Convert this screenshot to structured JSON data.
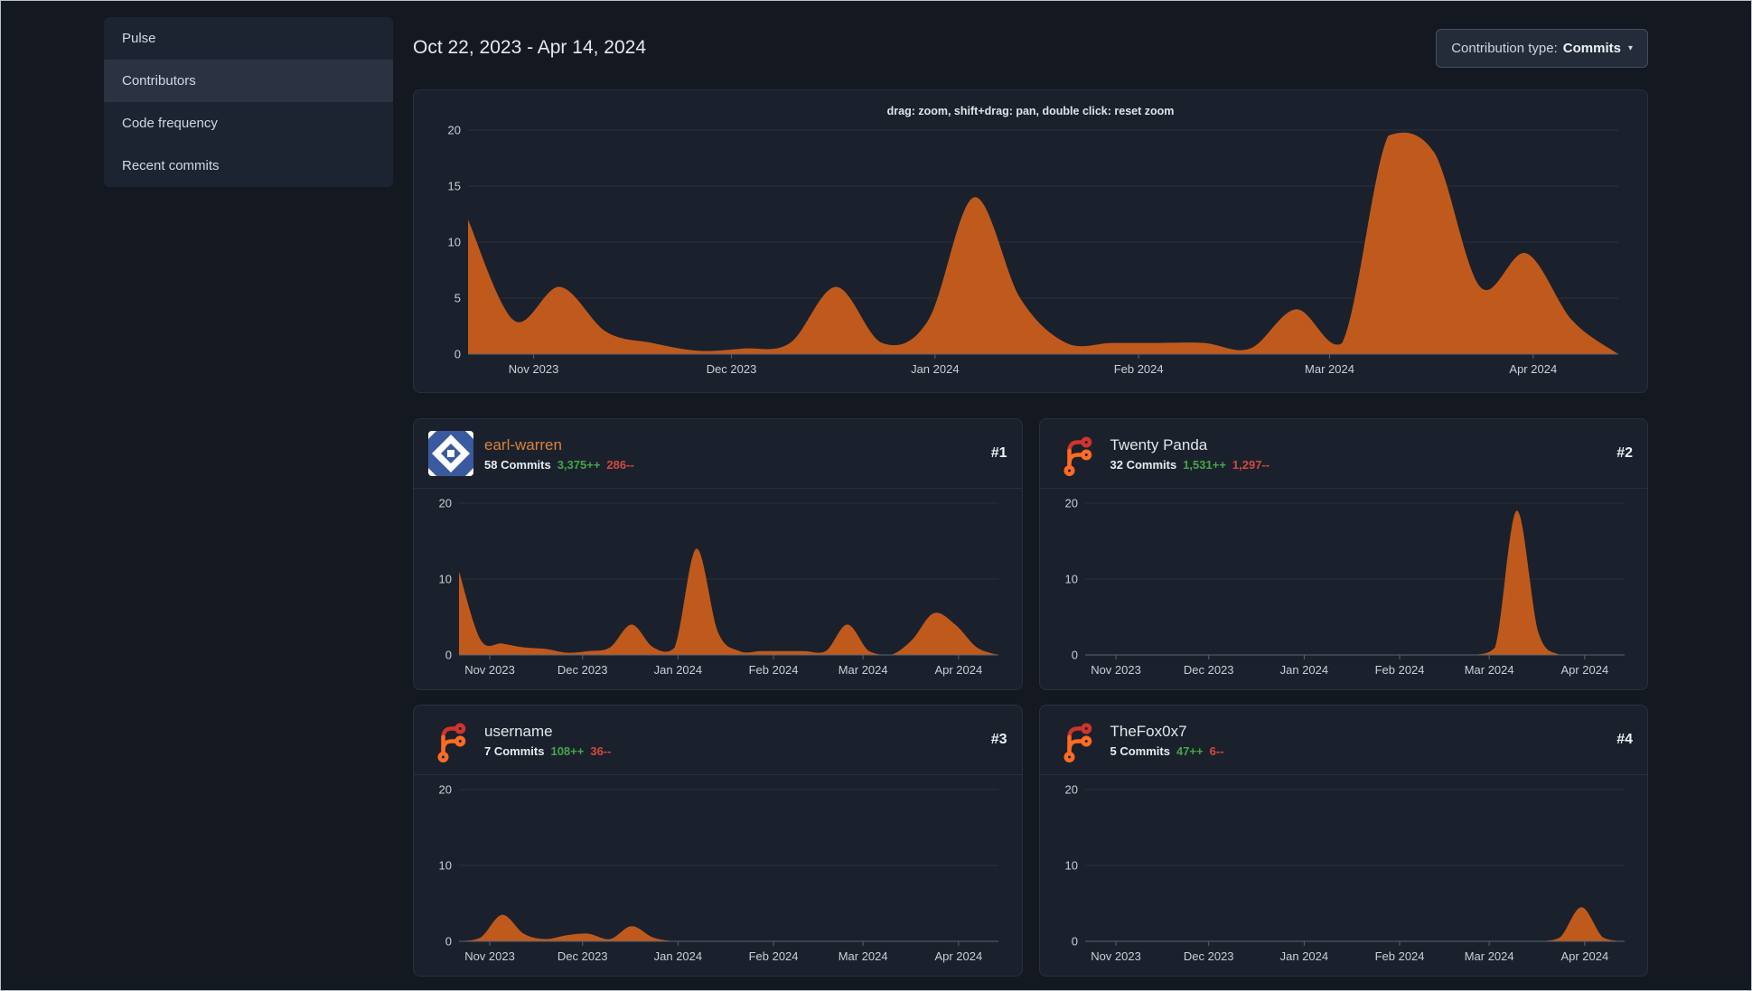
{
  "sidebar": {
    "items": [
      {
        "label": "Pulse",
        "active": false
      },
      {
        "label": "Contributors",
        "active": true
      },
      {
        "label": "Code frequency",
        "active": false
      },
      {
        "label": "Recent commits",
        "active": false
      }
    ]
  },
  "header": {
    "date_range": "Oct 22, 2023 - Apr 14, 2024",
    "contribution_type": {
      "label": "Contribution type:",
      "value": "Commits",
      "caret": "▾"
    }
  },
  "main_chart": {
    "hint": "drag: zoom, shift+drag: pan, double click: reset zoom"
  },
  "chart_data": {
    "type": "area",
    "ylim": [
      0,
      20
    ],
    "area_color": "#c05a1c",
    "grid_color": "#2b313d",
    "axis_color": "#596271",
    "tick_color": "#c9cfd8",
    "x_weekly": [
      "Oct 22",
      "Oct 29",
      "Nov 5",
      "Nov 12",
      "Nov 19",
      "Nov 26",
      "Dec 3",
      "Dec 10",
      "Dec 17",
      "Dec 24",
      "Dec 31",
      "Jan 7",
      "Jan 14",
      "Jan 21",
      "Jan 28",
      "Feb 4",
      "Feb 11",
      "Feb 18",
      "Feb 25",
      "Mar 3",
      "Mar 10",
      "Mar 17",
      "Mar 24",
      "Mar 31",
      "Apr 7",
      "Apr 14"
    ],
    "x_axis_ticks": [
      {
        "label": "Nov 2023",
        "pos": 0.057
      },
      {
        "label": "Dec 2023",
        "pos": 0.229
      },
      {
        "label": "Jan 2024",
        "pos": 0.406
      },
      {
        "label": "Feb 2024",
        "pos": 0.583
      },
      {
        "label": "Mar 2024",
        "pos": 0.749
      },
      {
        "label": "Apr 2024",
        "pos": 0.926
      }
    ],
    "main": {
      "yticks": [
        0,
        5,
        10,
        15,
        20
      ],
      "values": [
        12,
        3,
        6,
        2,
        1,
        0.3,
        0.5,
        1,
        6,
        1,
        3,
        14,
        5,
        1,
        1,
        1,
        1,
        0.5,
        4,
        1,
        19.5,
        18,
        6,
        9,
        3,
        0
      ]
    },
    "mini_yticks": [
      0,
      10,
      20
    ]
  },
  "contributors": [
    {
      "rank": "#1",
      "name": "earl-warren",
      "name_color": "#d9823e",
      "avatar": "identicon-blue",
      "commits": "58 Commits",
      "additions": "3,375++",
      "deletions": "286--",
      "values": [
        11,
        2,
        1.5,
        1,
        0.8,
        0.3,
        0.5,
        1,
        4,
        1,
        1,
        14,
        3,
        0.5,
        0.5,
        0.5,
        0.5,
        0.5,
        4,
        0.5,
        0,
        2,
        5.5,
        4,
        1,
        0
      ]
    },
    {
      "rank": "#2",
      "name": "Twenty Panda",
      "name_color": "",
      "avatar": "forgejo-logo",
      "commits": "32 Commits",
      "additions": "1,531++",
      "deletions": "1,297--",
      "values": [
        0,
        0,
        0,
        0,
        0,
        0,
        0,
        0,
        0,
        0,
        0,
        0,
        0,
        0,
        0,
        0,
        0,
        0,
        0,
        1,
        19,
        3,
        0,
        0,
        0,
        0
      ]
    },
    {
      "rank": "#3",
      "name": "username",
      "name_color": "",
      "avatar": "forgejo-logo",
      "commits": "7 Commits",
      "additions": "108++",
      "deletions": "36--",
      "values": [
        0,
        0.5,
        3.5,
        1,
        0.3,
        0.8,
        1,
        0.3,
        2,
        0.5,
        0,
        0,
        0,
        0,
        0,
        0,
        0,
        0,
        0,
        0,
        0,
        0,
        0,
        0,
        0,
        0
      ]
    },
    {
      "rank": "#4",
      "name": "TheFox0x7",
      "name_color": "",
      "avatar": "forgejo-logo",
      "commits": "5 Commits",
      "additions": "47++",
      "deletions": "6--",
      "values": [
        0,
        0,
        0,
        0,
        0,
        0,
        0,
        0,
        0,
        0,
        0,
        0,
        0,
        0,
        0,
        0,
        0,
        0,
        0,
        0,
        0,
        0,
        0.5,
        4.5,
        0.5,
        0
      ]
    }
  ]
}
